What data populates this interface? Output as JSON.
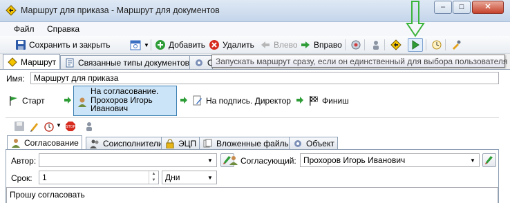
{
  "window": {
    "title": "Маршрут для приказа - Маршрут для документов"
  },
  "menu": [
    "Файл",
    "Справка"
  ],
  "toolbar": {
    "save_close": "Сохранить и закрыть",
    "add": "Добавить",
    "delete": "Удалить",
    "left": "Влево",
    "right": "Вправо"
  },
  "tabs": [
    "Маршрут",
    "Связанные типы документов",
    "О"
  ],
  "tooltip": "Запускать маршрут сразу, если он единственный для выбора пользователя",
  "name": {
    "label": "Имя:",
    "value": "Маршрут для приказа"
  },
  "route": {
    "start": "Старт",
    "step1_line1": "На согласование.",
    "step1_line2": "Прохоров Игорь",
    "step1_line3": "Иванович",
    "step2": "На подпись. Директор",
    "finish": "Финиш"
  },
  "inner_tabs": [
    "Согласование",
    "Соисполнители",
    "ЭЦП",
    "Вложенные файлы",
    "Объект"
  ],
  "form": {
    "author_label": "Автор:",
    "author_value": "",
    "approver_label": "Согласующий:",
    "approver_value": "Прохоров Игорь Иванович",
    "term_label": "Срок:",
    "term_value": "1",
    "term_unit": "Дни",
    "comment": "Прошу согласовать"
  },
  "colors": {
    "selected_step_bg": "#cce4f7",
    "selected_step_border": "#3c7fb1",
    "annotation_green": "#3bb43b"
  }
}
